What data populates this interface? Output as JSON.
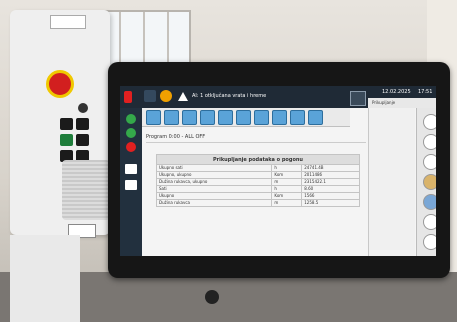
{
  "header": {
    "alert_text": "Al: 1 otključana vrata i hreme",
    "date": "12.02.2025",
    "time": "17:51",
    "active_tab": "Prikupljanje"
  },
  "program_line": "Program  0:00  -  ALL OFF",
  "table": {
    "title": "Prikupljanje podataka o pogonu",
    "rows": [
      {
        "label": "Ukupno sati",
        "unit": "h",
        "value": "24741.4B"
      },
      {
        "label": "Ukupno, ukupno",
        "unit": "Kom",
        "value": "2011486"
      },
      {
        "label": "Dužina rukavca, ukupno",
        "unit": "m",
        "value": "2315422.1"
      },
      {
        "label": "Sati",
        "unit": "h",
        "value": "8.60"
      },
      {
        "label": "Ukupno",
        "unit": "Kom",
        "value": "1566"
      },
      {
        "label": "Dužina rukavca",
        "unit": "m",
        "value": "1258.5"
      }
    ]
  },
  "colors": {
    "topbar": "#1f2a36",
    "sidebar": "#22303e",
    "tile_blue": "#5aa3d8",
    "status_red": "#e02020",
    "status_green": "#34a84a",
    "estop_red": "#d21f1f",
    "estop_yellow": "#f0c800"
  },
  "icons": [
    "status-light-icon",
    "home-icon",
    "warning-icon",
    "settings-icon",
    "keyboard-icon"
  ]
}
